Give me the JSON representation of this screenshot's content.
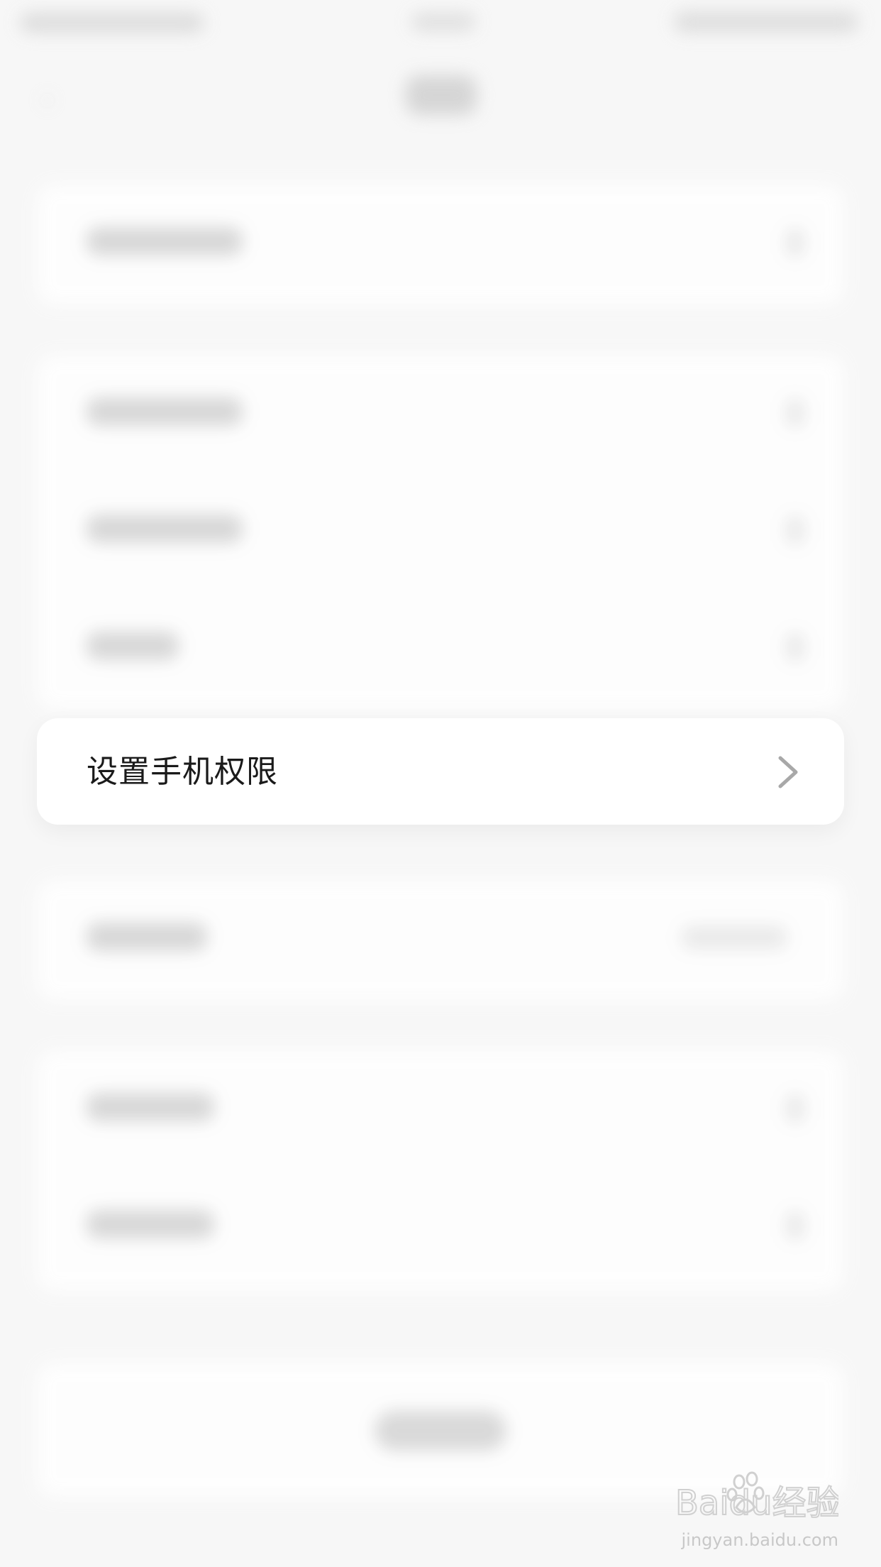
{
  "focused_row": {
    "label": "设置手机权限",
    "icon": "chevron-right-icon"
  },
  "watermark": {
    "logo_text": "Baidu经验",
    "url": "jingyan.baidu.com"
  },
  "colors": {
    "background": "#f7f7f7",
    "card": "#ffffff",
    "text": "#1a1a1a",
    "chevron": "#a8a8a8"
  }
}
